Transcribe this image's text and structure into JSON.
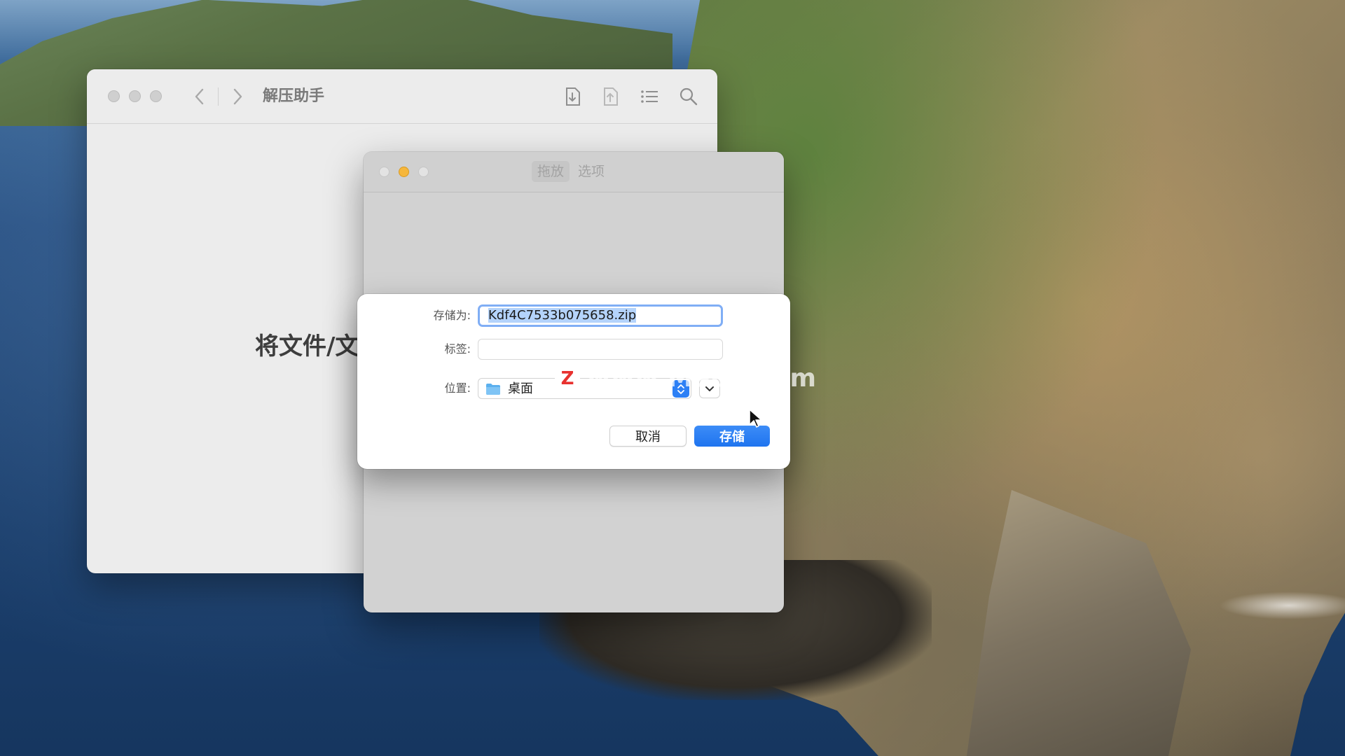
{
  "app_window": {
    "title": "解压助手",
    "drop_hint": "将文件/文",
    "toolbar": {
      "back_icon": "chevron-left-icon",
      "forward_icon": "chevron-right-icon",
      "extract_icon": "download-file-icon",
      "compress_icon": "upload-file-icon",
      "list_icon": "list-icon",
      "search_icon": "search-icon"
    }
  },
  "prefs_window": {
    "tabs": [
      {
        "label": "拖放",
        "active": true
      },
      {
        "label": "选项",
        "active": false
      }
    ]
  },
  "save_dialog": {
    "save_as_label": "存储为:",
    "save_as_value": "Kdf4C7533b075658.zip",
    "tags_label": "标签:",
    "tags_value": "",
    "location_label": "位置:",
    "location_value": "桌面",
    "location_icon": "folder-icon",
    "cancel_label": "取消",
    "save_label": "存储"
  },
  "watermark": {
    "logo": "Z",
    "text": "www.MacZ.com"
  },
  "colors": {
    "accent": "#1f74ef",
    "minimize": "#f6b73c",
    "focus_ring": "#80aef5"
  }
}
